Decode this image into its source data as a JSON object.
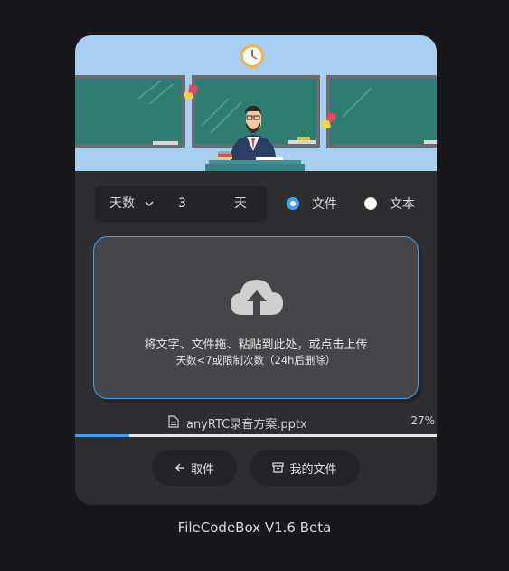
{
  "controls": {
    "select_value": "天数",
    "number_value": "3",
    "unit": "天"
  },
  "radios": [
    {
      "label": "文件",
      "checked": true
    },
    {
      "label": "文本",
      "checked": false
    }
  ],
  "dropzone": {
    "main_text": "将文字、文件拖、粘贴到此处，或点击上传",
    "sub_text": "天数<7或限制次数（24h后删除）"
  },
  "upload": {
    "file_name": "anyRTC录音方案.pptx",
    "percent_label": "27%",
    "progress_fraction": 0.15
  },
  "buttons": {
    "retrieve": "取件",
    "my_files": "我的文件"
  },
  "footer": "FileCodeBox V1.6 Beta",
  "colors": {
    "accent": "#409eff",
    "card": "#2e2e31",
    "background": "#18171c"
  }
}
